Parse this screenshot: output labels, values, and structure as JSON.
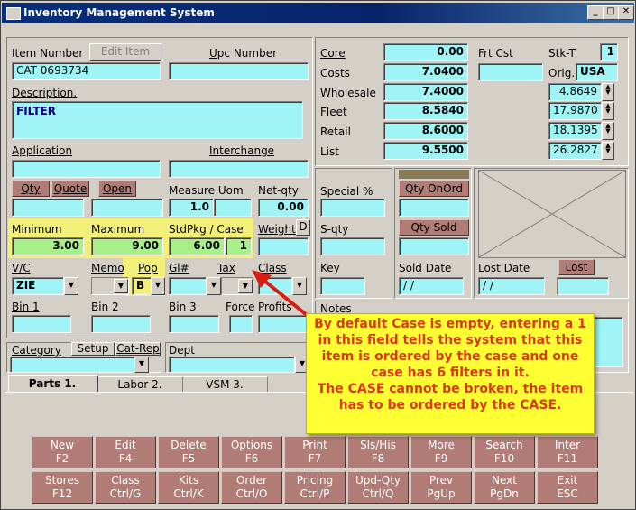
{
  "window": {
    "title": "Inventory Management System"
  },
  "left": {
    "item_number_label": "Item Number",
    "edit_item_button": "Edit Item",
    "upc_label_pre": "U",
    "upc_label_post": "pc  Number",
    "item_number_value": "CAT 0693734",
    "upc_value": "",
    "description_label": "Description.",
    "description_value": "FILTER",
    "application_label": "Application",
    "interchange_label": "Interchange",
    "qty_button": "Qty",
    "quote_button": "Quote",
    "open_button": "Open",
    "measure_uom_label": "Measure Uom",
    "net_qty_label": "Net-qty",
    "measure_uom_value": "1.0",
    "net_qty_value": "0.00",
    "minimum_label": "Minimum",
    "maximum_label": "Maximum",
    "stdpkg_label": "StdPkg / Case",
    "weight_label": "Weight",
    "weight_button": "D",
    "minimum_value": "3.00",
    "maximum_value": "9.00",
    "stdpkg_value": "6.00",
    "case_value": "1",
    "vc_label": "V/C",
    "memo_label": "Memo",
    "pop_label": "Pop",
    "gl_label": "Gl#",
    "tax_label": "Tax",
    "class_label": "Class",
    "vc_value": "ZIE",
    "pop_value": "B",
    "bin1_label": "Bin 1",
    "bin2_label": "Bin 2",
    "bin3_label": "Bin 3",
    "force_label": "Force",
    "profits_label": "Profits"
  },
  "pricing": {
    "core_label": "Core",
    "costs_label": "Costs",
    "wholesale_label": "Wholesale",
    "fleet_label": "Fleet",
    "retail_label": "Retail",
    "list_label": "List",
    "core_value": "0.00",
    "costs_value": "7.0400",
    "wholesale_value": "7.4000",
    "fleet_value": "8.5840",
    "retail_value": "8.6000",
    "list_value": "9.5500",
    "frt_cst_label": "Frt Cst",
    "stk_t_label": "Stk-T",
    "stk_t_value": "1",
    "orig_label": "Orig.",
    "orig_value": "USA",
    "pct_values": [
      "4.8649",
      "17.9870",
      "18.1395",
      "26.2827"
    ]
  },
  "mid": {
    "special_label": "Special %",
    "sqty_label": "S-qty",
    "key_label": "Key",
    "qty_onord_button": "Qty OnOrd",
    "qty_sold_button": "Qty Sold",
    "sold_date_label": "Sold Date",
    "sold_date_value": " / /",
    "lost_date_label": "Lost Date",
    "lost_date_value": " / /",
    "lost_button": "Lost",
    "notes_label": "Notes"
  },
  "bottom": {
    "category_label": "Category",
    "setup_tab": "Setup",
    "catrep_tab": "Cat-Rep",
    "dept_label": "Dept",
    "tabs": [
      "Parts 1.",
      "Labor 2.",
      "VSM 3."
    ]
  },
  "callout": {
    "line1": "By default Case is empty, entering a 1",
    "line2": "in this field tells the system that this",
    "line3": "item is ordered by the case and one",
    "line4": "case has 6 filters in it.",
    "line5": "The CASE cannot be broken, the item",
    "line6": "has to be ordered by the CASE."
  },
  "fkeys": [
    {
      "top": "New",
      "bottom": "F2"
    },
    {
      "top": "Edit",
      "bottom": "F4"
    },
    {
      "top": "Delete",
      "bottom": "F5"
    },
    {
      "top": "Options",
      "bottom": "F6"
    },
    {
      "top": "Print",
      "bottom": "F7"
    },
    {
      "top": "Sls/His",
      "bottom": "F8"
    },
    {
      "top": "More",
      "bottom": "F9"
    },
    {
      "top": "Search",
      "bottom": "F10"
    },
    {
      "top": "Inter",
      "bottom": "F11"
    },
    {
      "top": "Stores",
      "bottom": "F12"
    },
    {
      "top": "Class",
      "bottom": "Ctrl/G"
    },
    {
      "top": "Kits",
      "bottom": "Ctrl/K"
    },
    {
      "top": "Order",
      "bottom": "Ctrl/O"
    },
    {
      "top": "Pricing",
      "bottom": "Ctrl/P"
    },
    {
      "top": "Upd-Qty",
      "bottom": "Ctrl/Q"
    },
    {
      "top": "Prev",
      "bottom": "PgUp"
    },
    {
      "top": "Next",
      "bottom": "PgDn"
    },
    {
      "top": "Exit",
      "bottom": "ESC"
    }
  ]
}
